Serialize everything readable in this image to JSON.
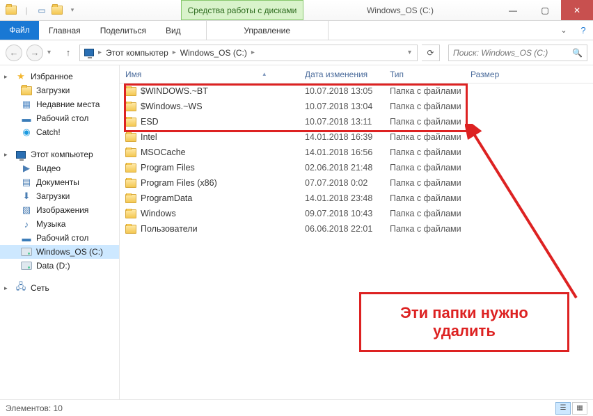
{
  "titlebar": {
    "contextual_label": "Средства работы с дисками",
    "window_title": "Windows_OS (C:)"
  },
  "ribbon": {
    "file": "Файл",
    "tabs": [
      "Главная",
      "Поделиться",
      "Вид"
    ],
    "context_tab": "Управление"
  },
  "breadcrumb": {
    "root": "Этот компьютер",
    "current": "Windows_OS (C:)"
  },
  "search": {
    "placeholder": "Поиск: Windows_OS (C:)"
  },
  "nav": {
    "favorites": {
      "label": "Избранное",
      "items": [
        "Загрузки",
        "Недавние места",
        "Рабочий стол",
        "Catch!"
      ]
    },
    "computer": {
      "label": "Этот компьютер",
      "items": [
        "Видео",
        "Документы",
        "Загрузки",
        "Изображения",
        "Музыка",
        "Рабочий стол",
        "Windows_OS (C:)",
        "Data (D:)"
      ]
    },
    "network": {
      "label": "Сеть"
    }
  },
  "columns": {
    "name": "Имя",
    "date": "Дата изменения",
    "type": "Тип",
    "size": "Размер"
  },
  "rows": [
    {
      "name": "$WINDOWS.~BT",
      "date": "10.07.2018 13:05",
      "type": "Папка с файлами"
    },
    {
      "name": "$Windows.~WS",
      "date": "10.07.2018 13:04",
      "type": "Папка с файлами"
    },
    {
      "name": "ESD",
      "date": "10.07.2018 13:11",
      "type": "Папка с файлами"
    },
    {
      "name": "Intel",
      "date": "14.01.2018 16:39",
      "type": "Папка с файлами"
    },
    {
      "name": "MSOCache",
      "date": "14.01.2018 16:56",
      "type": "Папка с файлами"
    },
    {
      "name": "Program Files",
      "date": "02.06.2018 21:48",
      "type": "Папка с файлами"
    },
    {
      "name": "Program Files (x86)",
      "date": "07.07.2018 0:02",
      "type": "Папка с файлами"
    },
    {
      "name": "ProgramData",
      "date": "14.01.2018 23:48",
      "type": "Папка с файлами"
    },
    {
      "name": "Windows",
      "date": "09.07.2018 10:43",
      "type": "Папка с файлами"
    },
    {
      "name": "Пользователи",
      "date": "06.06.2018 22:01",
      "type": "Папка с файлами"
    }
  ],
  "annotation": {
    "caption": "Эти папки нужно удалить"
  },
  "status": {
    "count_label": "Элементов: 10"
  }
}
